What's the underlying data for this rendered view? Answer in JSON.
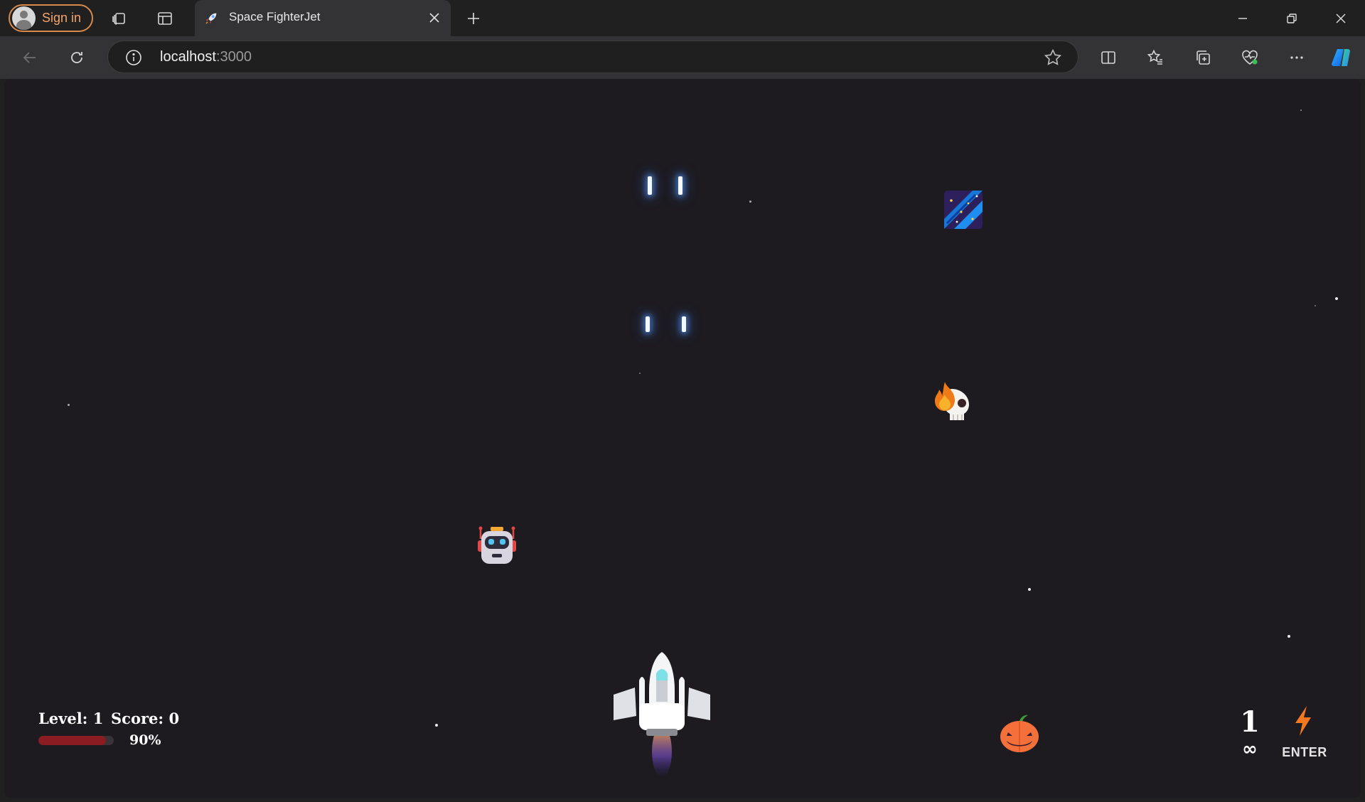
{
  "browser": {
    "signin_label": "Sign in",
    "tab_title": "Space FighterJet",
    "url_host": "localhost",
    "url_port": ":3000"
  },
  "game": {
    "level_text": "Level: 1",
    "score_text": "Score: 0",
    "health_text": "90%",
    "health_fraction": 0.9,
    "lives": "1",
    "ammo": "∞",
    "action_hint": "ENTER"
  },
  "colors": {
    "background": "#1d1b20",
    "health_bar": "#8b1c22",
    "bullet_glow": "#5aa0ff",
    "signin_accent": "#d98a4a"
  },
  "icons": {
    "player": "fighter-jet-icon",
    "enemies": [
      "comet-tile-icon",
      "flaming-skull-icon",
      "robot-icon",
      "jack-o-lantern-icon"
    ],
    "powerup": "lightning-bolt-icon"
  }
}
